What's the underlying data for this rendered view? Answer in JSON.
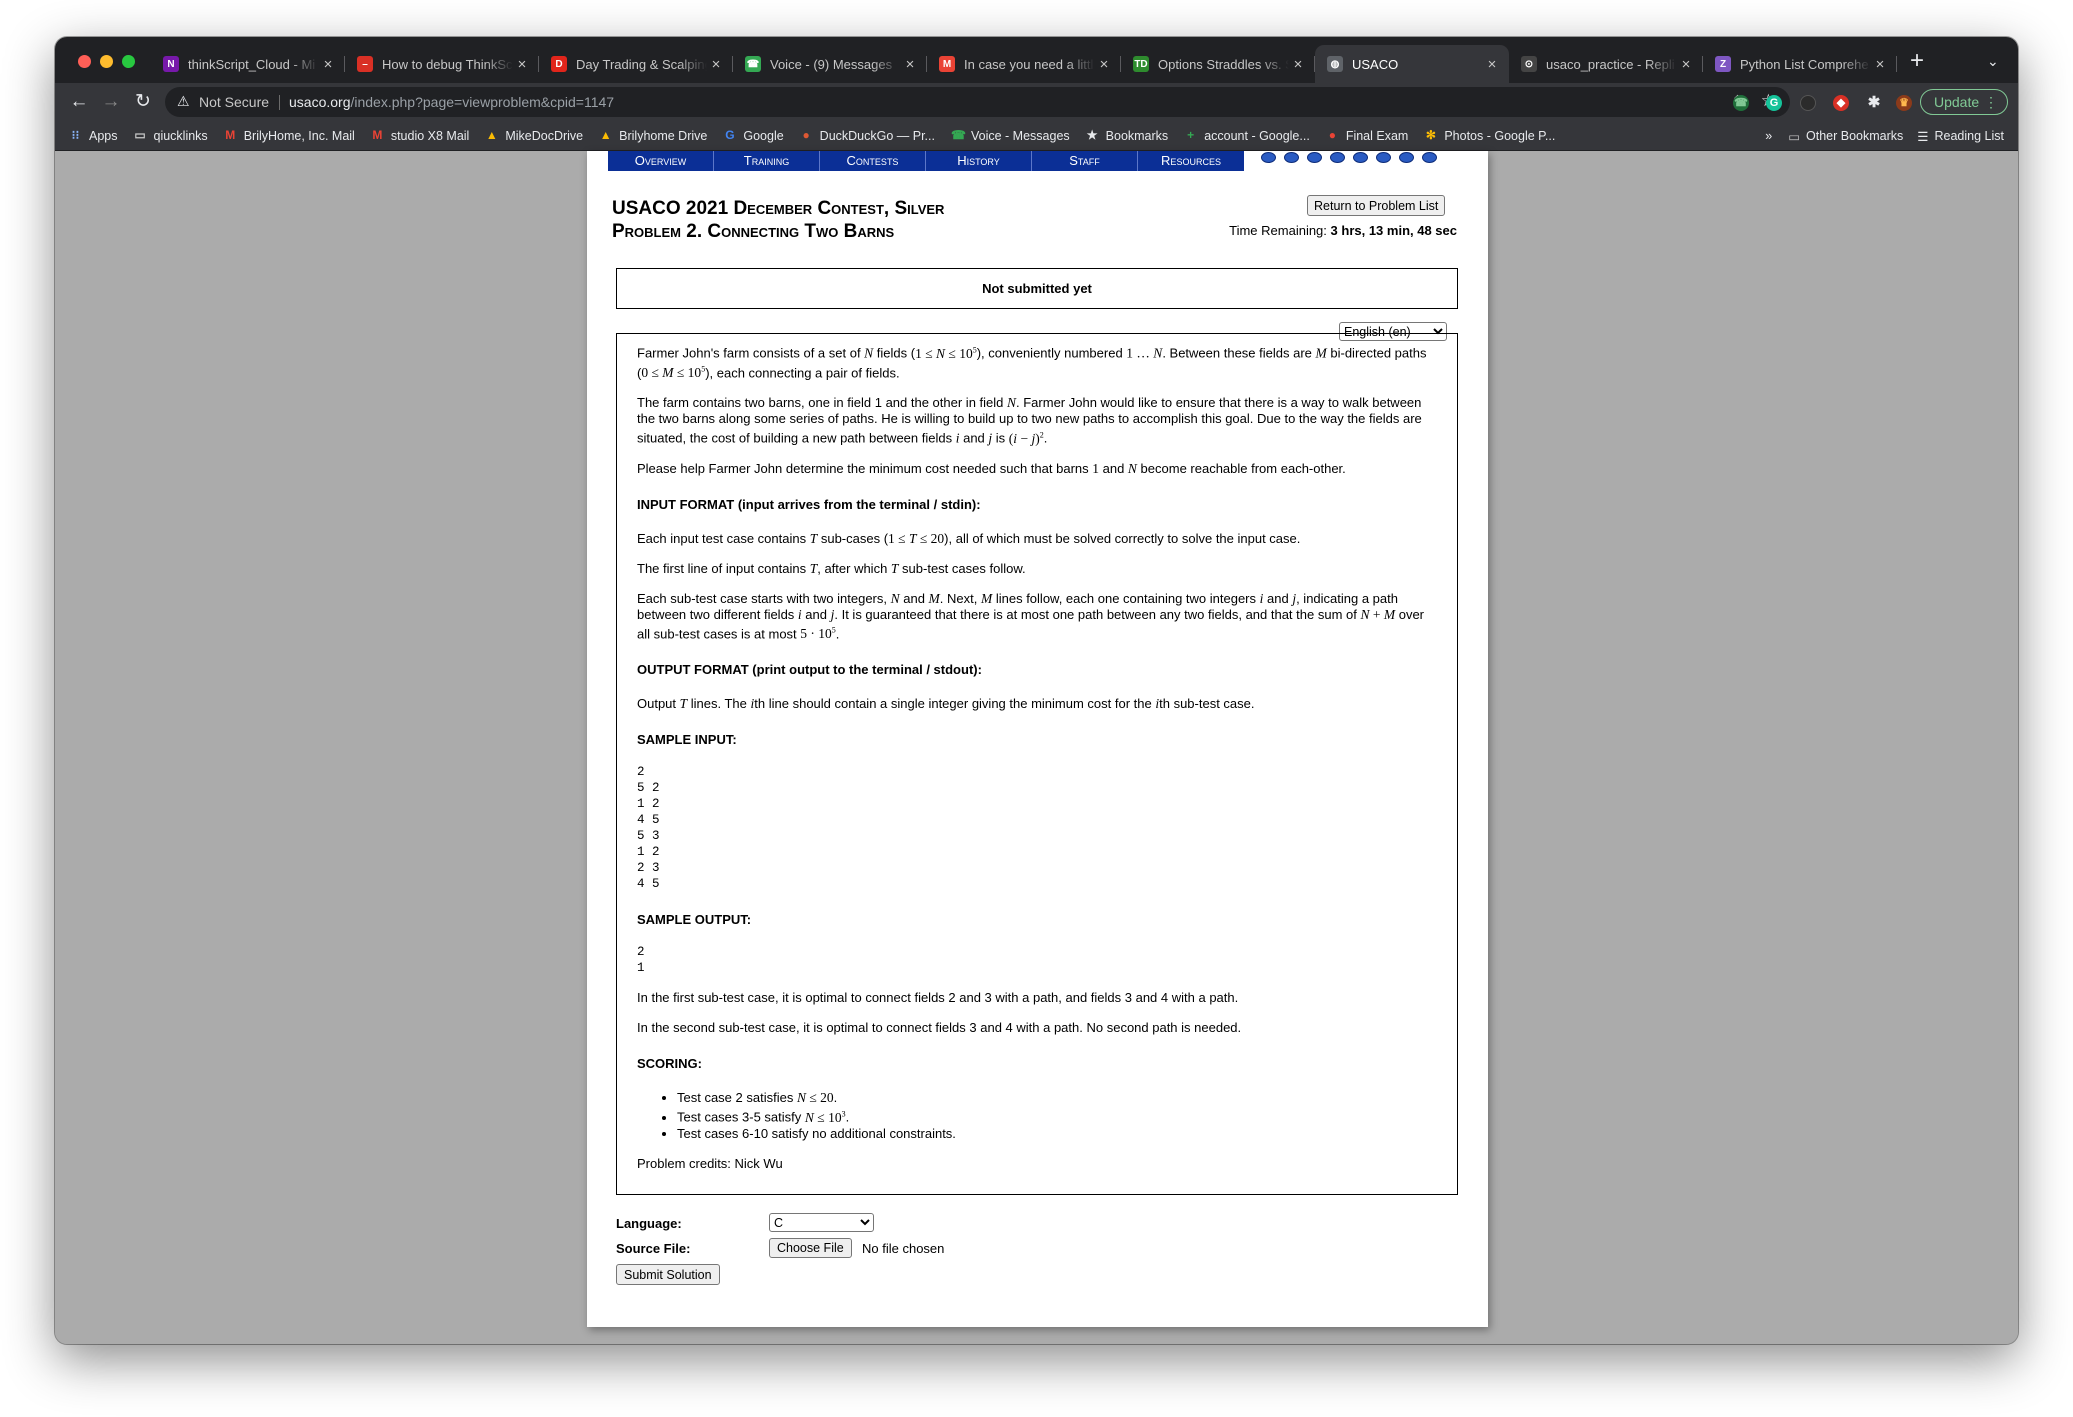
{
  "browser": {
    "tabs": [
      {
        "title": "thinkScript_Cloud - Mi",
        "icon": "onenote-icon",
        "color": "#7719aa",
        "glyph": "N"
      },
      {
        "title": "How to debug ThinkSc",
        "icon": "dash-icon",
        "color": "#d93025",
        "glyph": "–"
      },
      {
        "title": "Day Trading & Scalping",
        "icon": "trading-icon",
        "color": "#e1251b",
        "glyph": "D"
      },
      {
        "title": "Voice - (9) Messages",
        "icon": "phone-icon",
        "color": "#34a853",
        "glyph": "☎"
      },
      {
        "title": "In case you need a littl",
        "icon": "gmail-icon",
        "color": "#ea4335",
        "glyph": "M"
      },
      {
        "title": "Options Straddles vs. S",
        "icon": "td-icon",
        "color": "#2e8b2e",
        "glyph": "TD"
      },
      {
        "title": "USACO",
        "icon": "globe-icon",
        "color": "#5f6368",
        "glyph": "◍"
      },
      {
        "title": "usaco_practice - Repli",
        "icon": "replit-icon",
        "color": "#444444",
        "glyph": "⊙"
      },
      {
        "title": "Python List Comprehe",
        "icon": "python-icon",
        "color": "#7e57c2",
        "glyph": "Z"
      }
    ],
    "active_tab": 6,
    "new_tab": "+",
    "url_warning": "Not Secure",
    "url_host": "usaco.org",
    "url_path": "/index.php?page=viewproblem&cpid=1147",
    "update_label": "Update",
    "bookmarks": [
      {
        "label": "Apps",
        "icon": "apps-grid-icon"
      },
      {
        "label": "qiucklinks",
        "icon": "folder-icon"
      },
      {
        "label": "BrilyHome, Inc. Mail",
        "icon": "gmail-icon"
      },
      {
        "label": "studio X8 Mail",
        "icon": "gmail-icon"
      },
      {
        "label": "MikeDocDrive",
        "icon": "drive-icon"
      },
      {
        "label": "Brilyhome Drive",
        "icon": "drive-icon"
      },
      {
        "label": "Google",
        "icon": "google-icon"
      },
      {
        "label": "DuckDuckGo — Pr...",
        "icon": "duckduckgo-icon"
      },
      {
        "label": "Voice - Messages",
        "icon": "phone-icon"
      },
      {
        "label": "Bookmarks",
        "icon": "star-icon"
      },
      {
        "label": "account - Google...",
        "icon": "plus-icon"
      },
      {
        "label": "Final Exam",
        "icon": "apple-icon"
      },
      {
        "label": "Photos - Google P...",
        "icon": "pinwheel-icon"
      }
    ],
    "more_bookmarks": "»",
    "other_bookmarks": "Other Bookmarks",
    "reading_list": "Reading List"
  },
  "nav": [
    "Overview",
    "Training",
    "Contests",
    "History",
    "Staff",
    "Resources"
  ],
  "problem_header": {
    "line1": "USACO 2021 December Contest, Silver",
    "line2": "Problem 2. Connecting Two Barns",
    "return_btn": "Return to Problem List",
    "time_label": "Time Remaining:",
    "time_value": "3 hrs, 13 min, 48 sec"
  },
  "status": "Not submitted yet",
  "language_choice": "English (en)",
  "problem": {
    "input_heading": "INPUT FORMAT (input arrives from the terminal / stdin):",
    "output_heading": "OUTPUT FORMAT (print output to the terminal / stdout):",
    "sample_input_heading": "SAMPLE INPUT:",
    "sample_input": "2\n5 2\n1 2\n4 5\n5 3\n1 2\n2 3\n4 5",
    "sample_output_heading": "SAMPLE OUTPUT:",
    "sample_output": "2\n1",
    "explain1": "In the first sub-test case, it is optimal to connect fields 2 and 3 with a path, and fields 3 and 4 with a path.",
    "explain2": "In the second sub-test case, it is optimal to connect fields 3 and 4 with a path. No second path is needed.",
    "scoring_heading": "SCORING:",
    "credits": "Problem credits: Nick Wu"
  },
  "form": {
    "language_label": "Language:",
    "language_value": "C",
    "source_label": "Source File:",
    "choose_file": "Choose File",
    "no_file": "No file chosen",
    "submit": "Submit Solution"
  }
}
